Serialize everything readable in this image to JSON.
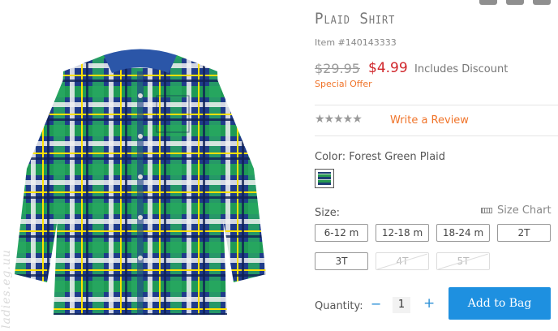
{
  "product": {
    "title": "Plaid Shirt",
    "item_number": "Item #140143333",
    "original_price": "$29.95",
    "sale_price": "$4.99",
    "discount_note": "Includes Discount",
    "promo": "Special Offer",
    "rating_stars": "★★★★★",
    "write_review": "Write a Review"
  },
  "color": {
    "label": "Color: Forest Green Plaid"
  },
  "size": {
    "label": "Size:",
    "chart_label": "Size Chart",
    "options": [
      {
        "label": "6-12 m",
        "available": true
      },
      {
        "label": "12-18 m",
        "available": true
      },
      {
        "label": "18-24 m",
        "available": true
      },
      {
        "label": "2T",
        "available": true
      },
      {
        "label": "3T",
        "available": true
      },
      {
        "label": "4T",
        "available": false
      },
      {
        "label": "5T",
        "available": false
      }
    ]
  },
  "quantity": {
    "label": "Quantity:",
    "minus": "−",
    "value": "1",
    "plus": "+"
  },
  "actions": {
    "add_to_bag": "Add to Bag"
  },
  "image": {
    "watermark": "ladies.eg.uu"
  },
  "colors": {
    "accent": "#1e90e0",
    "sale": "#d0262b",
    "promo": "#f0742a"
  }
}
